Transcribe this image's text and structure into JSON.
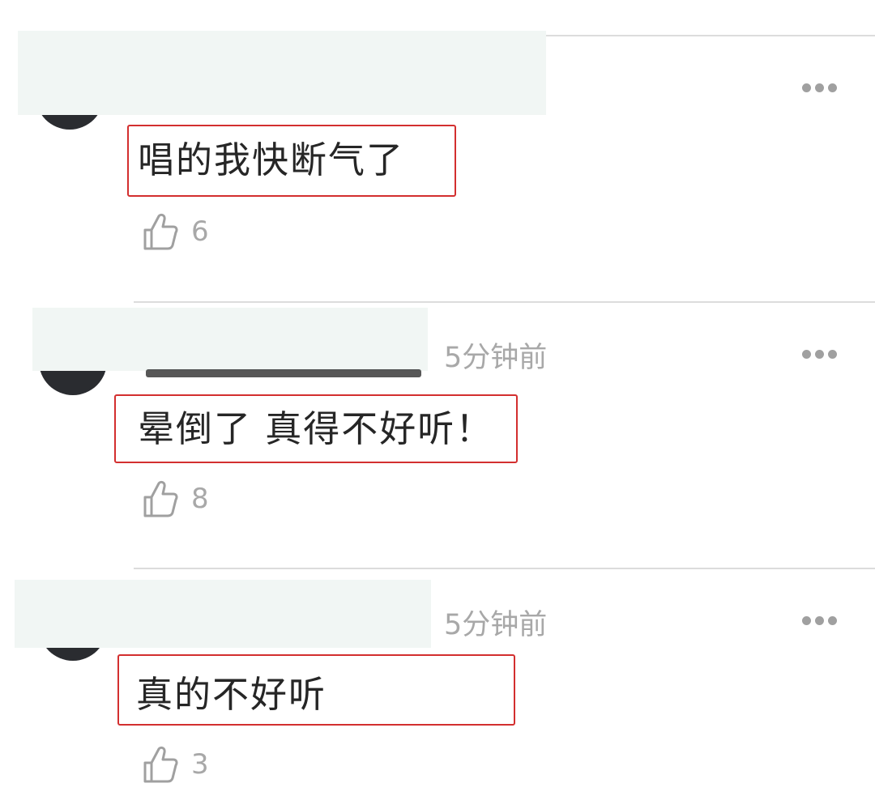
{
  "comments": [
    {
      "timestamp": "",
      "text": "唱的我快断气了",
      "likes": "6"
    },
    {
      "timestamp": "5分钟前",
      "text": "晕倒了 真得不好听！",
      "likes": "8"
    },
    {
      "timestamp": "5分钟前",
      "text": "真的不好听",
      "likes": "3"
    }
  ],
  "icons": {
    "more": "more-options-icon",
    "like": "thumbs-up-icon"
  },
  "colors": {
    "highlight_border": "#d32f2f",
    "muted_text": "#a8a8a8",
    "body_text": "#262626",
    "divider": "#dcdcdc",
    "redaction": "#f1f6f4"
  }
}
